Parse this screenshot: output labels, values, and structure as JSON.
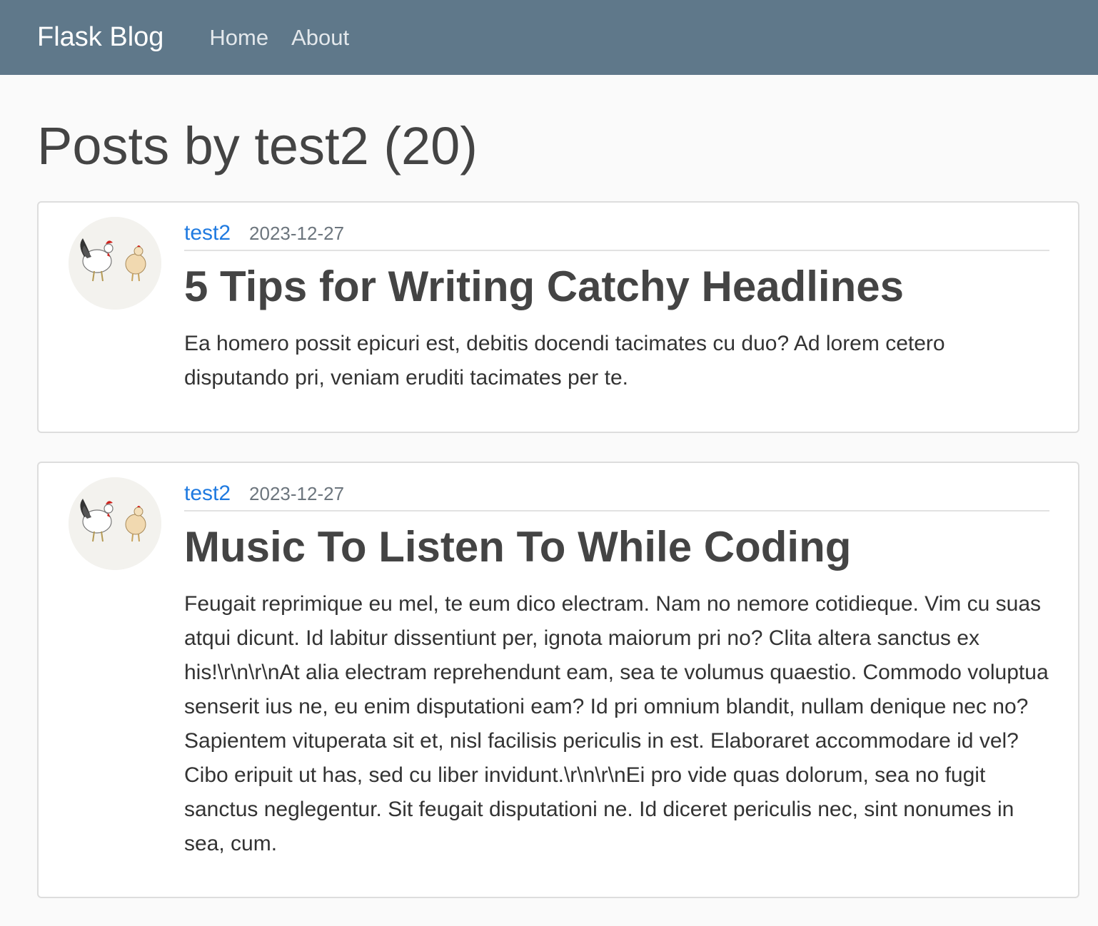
{
  "navbar": {
    "brand": "Flask Blog",
    "links": [
      "Home",
      "About"
    ],
    "background": "#5f788a"
  },
  "page": {
    "title": "Posts by test2 (20)"
  },
  "posts": [
    {
      "author": "test2",
      "date": "2023-12-27",
      "title": "5 Tips for Writing Catchy Headlines",
      "content": "Ea homero possit epicuri est, debitis docendi tacimates cu duo? Ad lorem cetero disputando pri, veniam eruditi tacimates per te.",
      "avatar": {
        "icon": "rooster-hen-illustration",
        "labels": [
          "Rooster",
          "Hen"
        ]
      }
    },
    {
      "author": "test2",
      "date": "2023-12-27",
      "title": "Music To Listen To While Coding",
      "content": "Feugait reprimique eu mel, te eum dico electram. Nam no nemore cotidieque. Vim cu suas atqui dicunt. Id labitur dissentiunt per, ignota maiorum pri no? Clita altera sanctus ex his!\\r\\n\\r\\nAt alia electram reprehendunt eam, sea te volumus quaestio. Commodo voluptua senserit ius ne, eu enim disputationi eam? Id pri omnium blandit, nullam denique nec no? Sapientem vituperata sit et, nisl facilisis periculis in est. Elaboraret accommodare id vel? Cibo eripuit ut has, sed cu liber invidunt.\\r\\n\\r\\nEi pro vide quas dolorum, sea no fugit sanctus neglegentur. Sit feugait disputationi ne. Id diceret periculis nec, sint nonumes in sea, cum.",
      "avatar": {
        "icon": "rooster-hen-illustration",
        "labels": [
          "Rooster",
          "Hen"
        ]
      }
    }
  ],
  "colors": {
    "link": "#1f7ae0",
    "muted": "#6c757d",
    "text": "#444444"
  }
}
